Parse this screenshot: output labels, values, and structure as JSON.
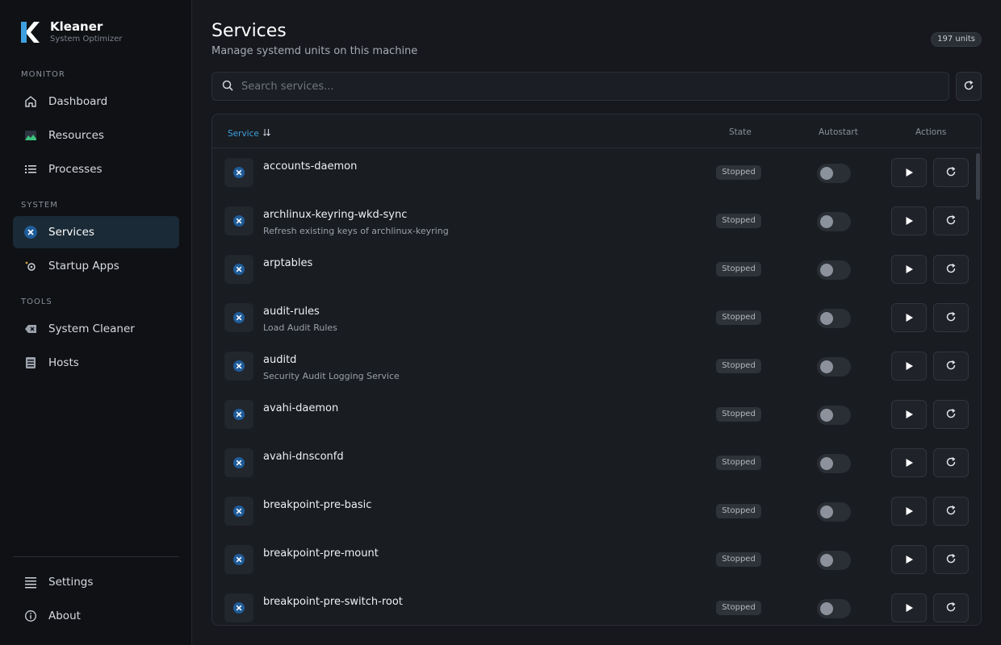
{
  "app": {
    "name": "Kleaner",
    "subtitle": "System Optimizer",
    "accent": "#3ea0e0"
  },
  "sidebar": {
    "sections": [
      {
        "label": "MONITOR"
      },
      {
        "label": "SYSTEM"
      },
      {
        "label": "TOOLS"
      }
    ],
    "items": [
      {
        "label": "Dashboard",
        "icon": "home-icon"
      },
      {
        "label": "Resources",
        "icon": "image-chart-icon"
      },
      {
        "label": "Processes",
        "icon": "list-icon"
      },
      {
        "label": "Services",
        "icon": "tools-icon",
        "active": true
      },
      {
        "label": "Startup Apps",
        "icon": "gear-sparkle-icon"
      },
      {
        "label": "System Cleaner",
        "icon": "backspace-icon"
      },
      {
        "label": "Hosts",
        "icon": "server-icon"
      }
    ],
    "footer": [
      {
        "label": "Settings",
        "icon": "settings-lines-icon"
      },
      {
        "label": "About",
        "icon": "info-icon"
      }
    ]
  },
  "header": {
    "title": "Services",
    "subtitle": "Manage systemd units on this machine",
    "badge": "197 units"
  },
  "search": {
    "placeholder": "Search services..."
  },
  "table": {
    "columns": {
      "service": "Service",
      "state": "State",
      "autostart": "Autostart",
      "actions": "Actions"
    },
    "rows": [
      {
        "name": "accounts-daemon",
        "description": "",
        "state": "Stopped",
        "autostart": false
      },
      {
        "name": "archlinux-keyring-wkd-sync",
        "description": "Refresh existing keys of archlinux-keyring",
        "state": "Stopped",
        "autostart": false
      },
      {
        "name": "arptables",
        "description": "",
        "state": "Stopped",
        "autostart": false
      },
      {
        "name": "audit-rules",
        "description": "Load Audit Rules",
        "state": "Stopped",
        "autostart": false
      },
      {
        "name": "auditd",
        "description": "Security Audit Logging Service",
        "state": "Stopped",
        "autostart": false
      },
      {
        "name": "avahi-daemon",
        "description": "",
        "state": "Stopped",
        "autostart": false
      },
      {
        "name": "avahi-dnsconfd",
        "description": "",
        "state": "Stopped",
        "autostart": false
      },
      {
        "name": "breakpoint-pre-basic",
        "description": "",
        "state": "Stopped",
        "autostart": false
      },
      {
        "name": "breakpoint-pre-mount",
        "description": "",
        "state": "Stopped",
        "autostart": false
      },
      {
        "name": "breakpoint-pre-switch-root",
        "description": "",
        "state": "Stopped",
        "autostart": false
      }
    ]
  }
}
